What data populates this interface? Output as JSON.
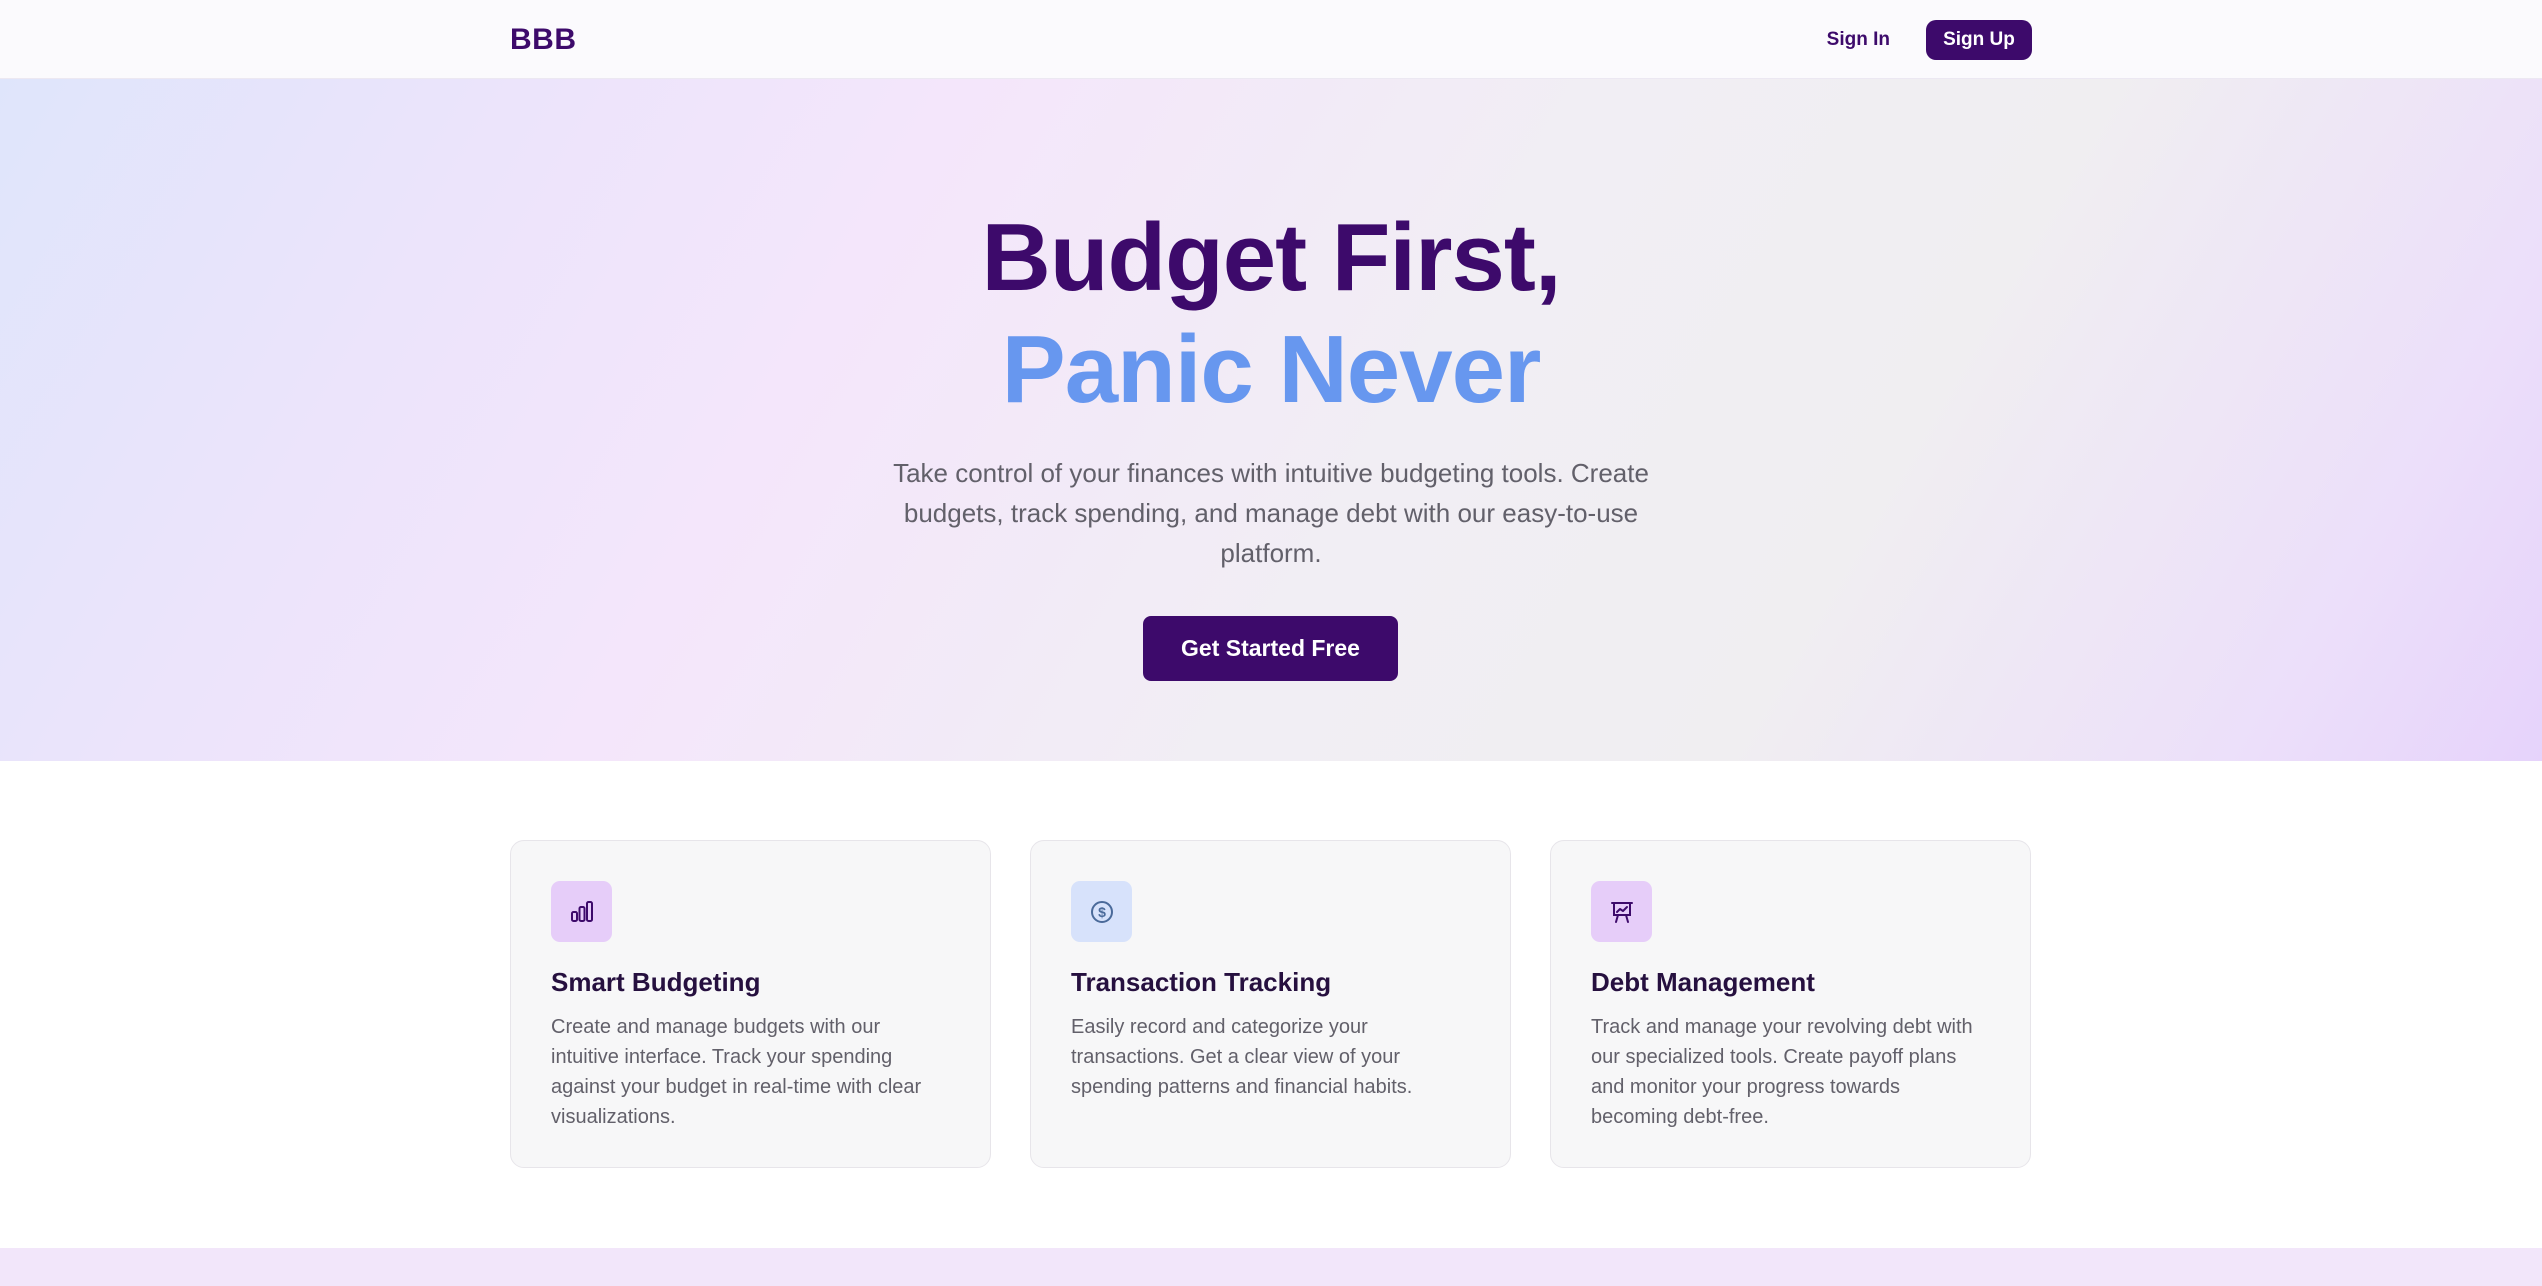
{
  "nav": {
    "logo": "BBB",
    "sign_in": "Sign In",
    "sign_up": "Sign Up"
  },
  "hero": {
    "title_line1": "Budget First,",
    "title_line2": "Panic Never",
    "subtitle": "Take control of your finances with intuitive budgeting tools. Create budgets, track spending, and manage debt with our easy-to-use platform.",
    "cta": "Get Started Free"
  },
  "features": [
    {
      "icon": "bar-chart-icon",
      "title": "Smart Budgeting",
      "text": "Create and manage budgets with our intuitive interface. Track your spending against your budget in real-time with clear visualizations."
    },
    {
      "icon": "dollar-circle-icon",
      "title": "Transaction Tracking",
      "text": "Easily record and categorize your transactions. Get a clear view of your spending patterns and financial habits."
    },
    {
      "icon": "presentation-chart-icon",
      "title": "Debt Management",
      "text": "Track and manage your revolving debt with our specialized tools. Create payoff plans and monitor your progress towards becoming debt-free."
    }
  ],
  "colors": {
    "brand": "#3d0a6b",
    "accent_blue": "#6797ef",
    "icon_purple_bg": "#e6cdf9",
    "icon_blue_bg": "#d7e2fb"
  }
}
